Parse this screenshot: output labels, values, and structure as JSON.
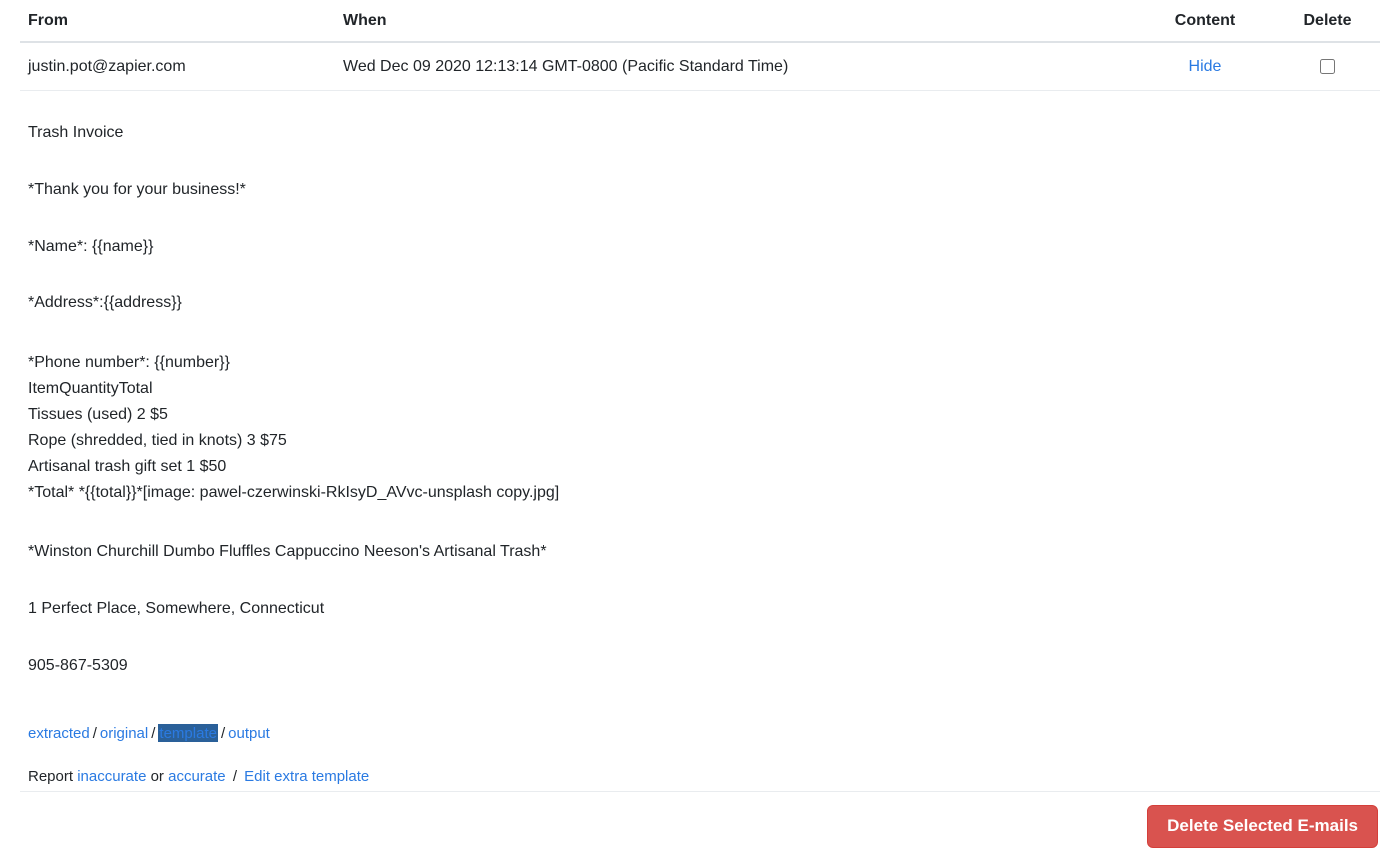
{
  "table": {
    "headers": {
      "from": "From",
      "when": "When",
      "content": "Content",
      "delete": "Delete"
    },
    "rows": [
      {
        "from": "justin.pot@zapier.com",
        "when": "Wed Dec 09 2020 12:13:14 GMT-0800 (Pacific Standard Time)",
        "content_link": "Hide",
        "checkbox_checked": false
      }
    ]
  },
  "message": {
    "subject": "Trash Invoice",
    "greeting": "*Thank you for your business!*",
    "name_line": "*Name*: {{name}}",
    "address_line": "*Address*:{{address}}",
    "details_block": "*Phone number*: {{number}}\nItemQuantityTotal\nTissues (used) 2 $5\nRope (shredded, tied in knots) 3 $75\nArtisanal trash gift set 1 $50\n*Total* *{{total}}*[image: pawel-czerwinski-RkIsyD_AVvc-unsplash copy.jpg]",
    "signature": "*Winston Churchill Dumbo Fluffles Cappuccino Neeson's Artisanal Trash*",
    "address": "1 Perfect Place, Somewhere, Connecticut",
    "phone": "905-867-5309"
  },
  "footer": {
    "view_links": {
      "extracted": "extracted",
      "original": "original",
      "template": "template",
      "output": "output",
      "separator": "/"
    },
    "report_row": {
      "report_label": "Report",
      "inaccurate": "inaccurate",
      "or_label": "or",
      "accurate": "accurate",
      "separator": "/",
      "edit_extra_template": "Edit extra template"
    }
  },
  "actions": {
    "delete_selected": "Delete Selected E-mails"
  },
  "colors": {
    "link": "#2a7ae2",
    "selection_bg": "#2a6099",
    "danger": "#d9534f",
    "border": "#dee2e6",
    "text": "#212529"
  }
}
